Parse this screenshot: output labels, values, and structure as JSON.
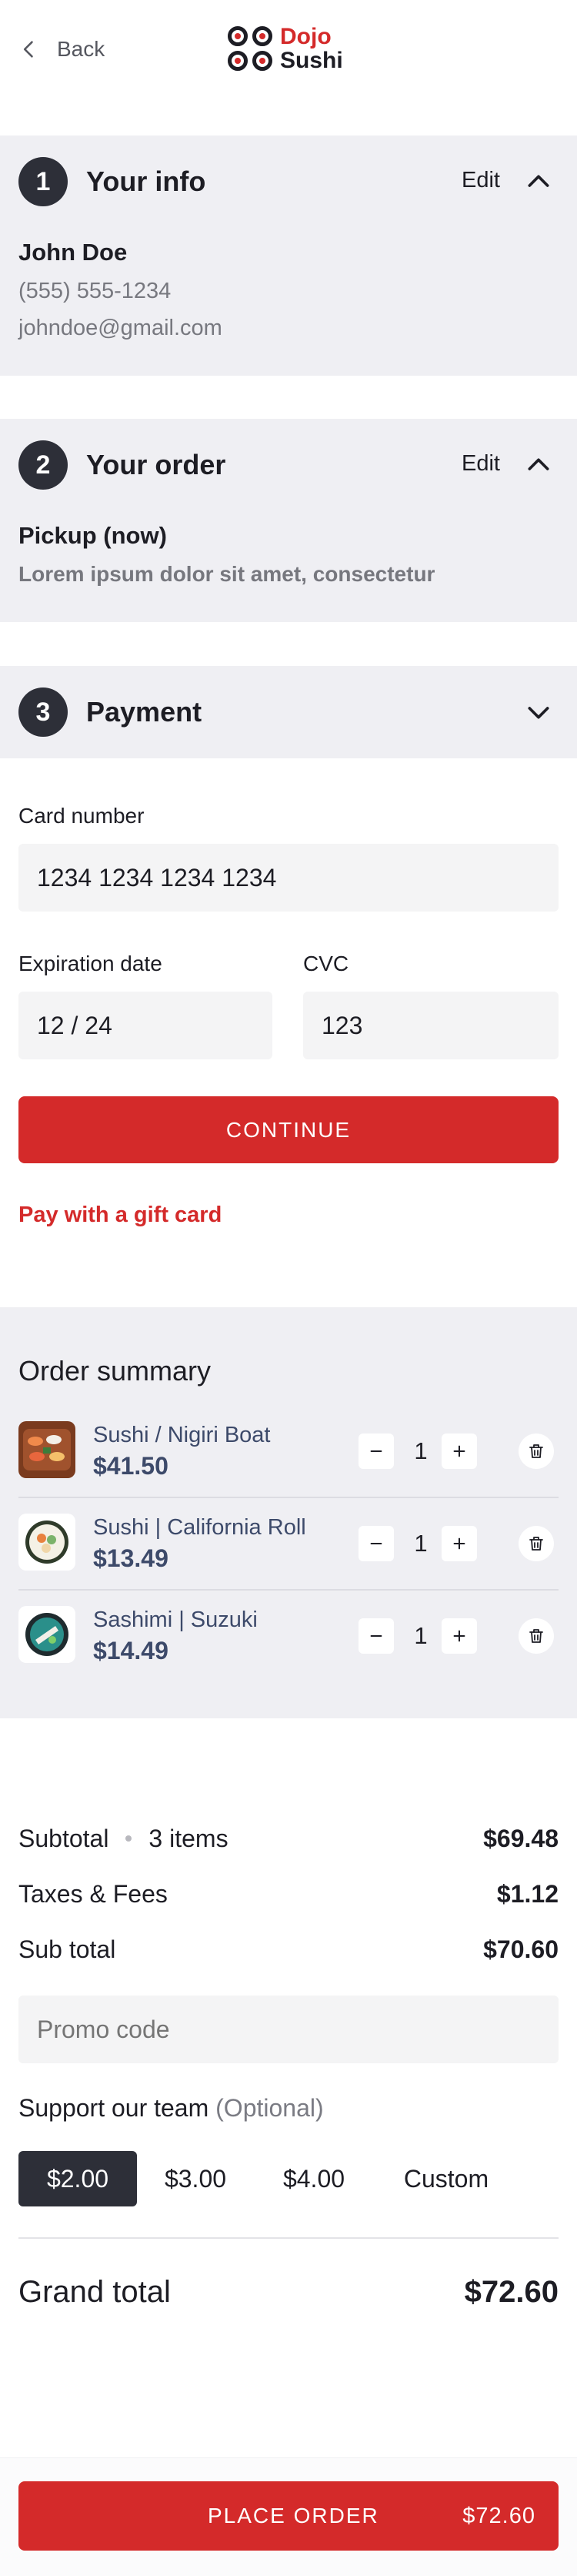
{
  "header": {
    "back_label": "Back",
    "logo_line1": "Dojo",
    "logo_line2": "Sushi"
  },
  "colors": {
    "brand_red": "#d42a2a",
    "dark": "#2d2f38",
    "section_bg": "#efeff3",
    "field_bg": "#f4f4f5"
  },
  "info": {
    "step": "1",
    "title": "Your info",
    "edit_label": "Edit",
    "name": "John Doe",
    "phone": "(555) 555-1234",
    "email": "johndoe@gmail.com"
  },
  "order": {
    "step": "2",
    "title": "Your order",
    "edit_label": "Edit",
    "method": "Pickup (now)",
    "description": "Lorem ipsum dolor sit amet, consectetur"
  },
  "payment": {
    "step": "3",
    "title": "Payment",
    "card_label": "Card number",
    "card_value": "1234 1234 1234 1234",
    "exp_label": "Expiration date",
    "exp_value": "12 / 24",
    "cvc_label": "CVC",
    "cvc_value": "123",
    "continue_label": "CONTINUE",
    "gift_label": "Pay with a gift card"
  },
  "summary": {
    "title": "Order summary",
    "items": [
      {
        "name": "Sushi / Nigiri Boat",
        "price": "$41.50",
        "qty": "1",
        "icon": "sushi-boat-icon"
      },
      {
        "name": "Sushi | California Roll",
        "price": "$13.49",
        "qty": "1",
        "icon": "california-roll-icon"
      },
      {
        "name": "Sashimi | Suzuki",
        "price": "$14.49",
        "qty": "1",
        "icon": "sashimi-icon"
      }
    ]
  },
  "totals": {
    "subtotal_label": "Subtotal",
    "items_count": "3 items",
    "subtotal_value": "$69.48",
    "taxes_label": "Taxes & Fees",
    "taxes_value": "$1.12",
    "sub_total_label": "Sub total",
    "sub_total_value": "$70.60",
    "promo_placeholder": "Promo code",
    "support_label": "Support our team",
    "support_optional": "(Optional)",
    "tips": [
      "$2.00",
      "$3.00",
      "$4.00",
      "Custom"
    ],
    "selected_tip": "$2.00",
    "grand_label": "Grand total",
    "grand_value": "$72.60"
  },
  "footer": {
    "place_label": "PLACE ORDER",
    "place_price": "$72.60"
  }
}
